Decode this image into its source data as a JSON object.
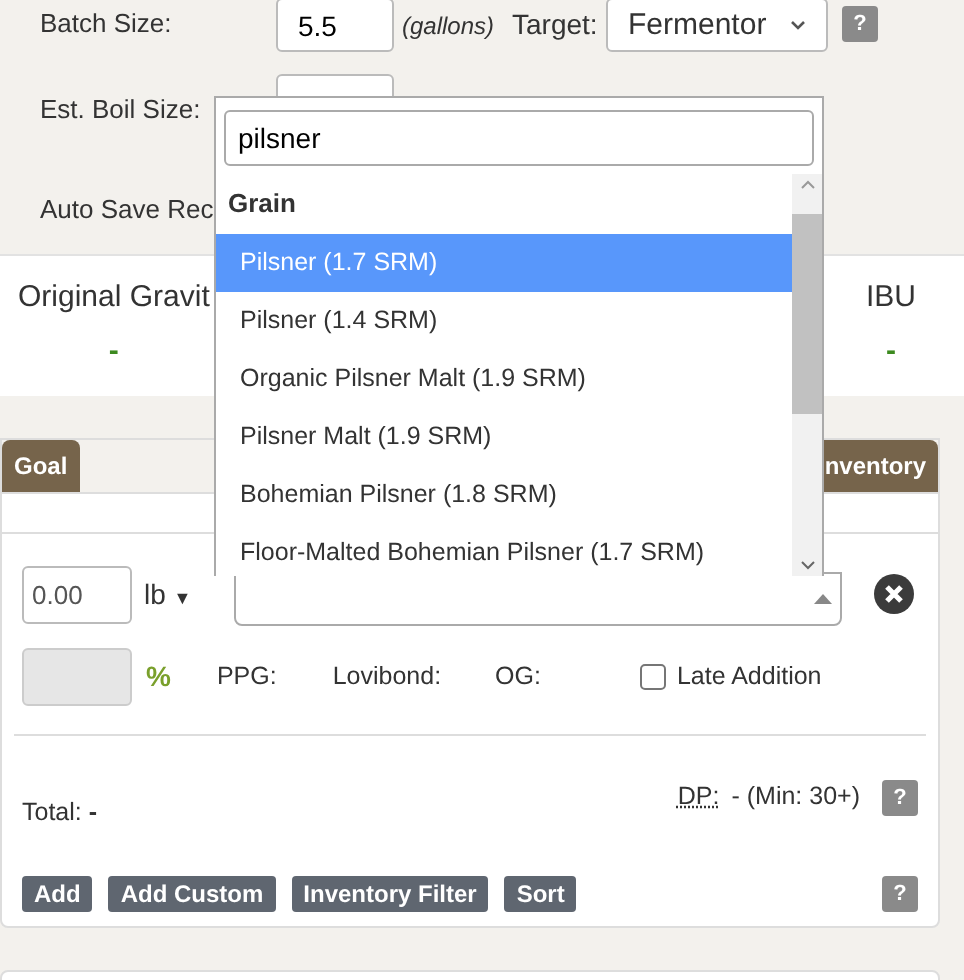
{
  "recipe_settings": {
    "batch_size": {
      "label": "Batch Size:",
      "value": "5.5",
      "unit": "(gallons)"
    },
    "target": {
      "label": "Target:",
      "value": "Fermentor"
    },
    "help": "?",
    "boil_size": {
      "label": "Est. Boil Size:"
    },
    "auto_save": {
      "label": "Auto Save Rec"
    }
  },
  "stats": [
    {
      "label": "Original Gravit",
      "value": "-"
    },
    {
      "label": "IBU",
      "value": "-"
    }
  ],
  "tabs": [
    {
      "label": "Goal"
    },
    {
      "label": "nventory"
    }
  ],
  "fermentable": {
    "amount": "0.00",
    "unit": "lb",
    "unit_caret": "▼",
    "percent": "%",
    "fields": [
      "PPG:",
      "Lovibond:",
      "OG:"
    ],
    "late_addition": {
      "label": "Late Addition",
      "checked": false
    }
  },
  "total": {
    "label": "Total:",
    "value": "-"
  },
  "dp": {
    "label": "DP:",
    "value": "- (Min: 30+)",
    "help": "?"
  },
  "buttons": [
    "Add",
    "Add Custom",
    "Inventory Filter",
    "Sort"
  ],
  "help": "?",
  "dropdown": {
    "search": "pilsner",
    "group": "Grain",
    "options": [
      {
        "label": "Pilsner (1.7 SRM)",
        "selected": true
      },
      {
        "label": "Pilsner (1.4 SRM)",
        "selected": false
      },
      {
        "label": "Organic Pilsner Malt (1.9 SRM)",
        "selected": false
      },
      {
        "label": "Pilsner Malt (1.9 SRM)",
        "selected": false
      },
      {
        "label": "Bohemian Pilsner (1.8 SRM)",
        "selected": false
      },
      {
        "label": "Floor-Malted Bohemian Pilsner (1.7 SRM)",
        "selected": false
      }
    ]
  }
}
